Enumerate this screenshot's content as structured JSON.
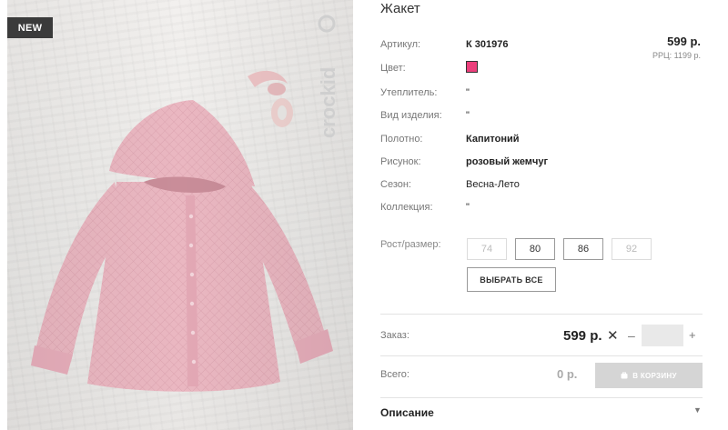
{
  "product_image": {
    "badge": "NEW",
    "brand": "crockid"
  },
  "product": {
    "title": "Жакет",
    "price": "599 р.",
    "rrp": "РРЦ: 1199 р.",
    "swatch_color": "#ec3f7c"
  },
  "attributes": [
    {
      "label": "Артикул:",
      "value": "К 301976"
    },
    {
      "label": "Цвет:",
      "value": ""
    },
    {
      "label": "Утеплитель:",
      "value": "\""
    },
    {
      "label": "Вид изделия:",
      "value": "\""
    },
    {
      "label": "Полотно:",
      "value": "Капитоний"
    },
    {
      "label": "Рисунок:",
      "value": "розовый жемчуг"
    },
    {
      "label": "Сезон:",
      "value": "Весна-Лето"
    },
    {
      "label": "Коллекция:",
      "value": "\""
    }
  ],
  "sizes": {
    "label": "Рост/размер:",
    "options": [
      {
        "value": "74",
        "available": false
      },
      {
        "value": "80",
        "available": true
      },
      {
        "value": "86",
        "available": true
      },
      {
        "value": "92",
        "available": false
      }
    ],
    "select_all": "ВЫБРАТЬ ВСЕ"
  },
  "order": {
    "label": "Заказ:",
    "price": "599 р.",
    "times": "✕",
    "minus": "–",
    "quantity": "",
    "plus": "+"
  },
  "total": {
    "label": "Всего:",
    "value": "0 р.",
    "cart_button": "В КОРЗИНУ"
  },
  "description": {
    "title": "Описание",
    "arrow": "▼"
  }
}
